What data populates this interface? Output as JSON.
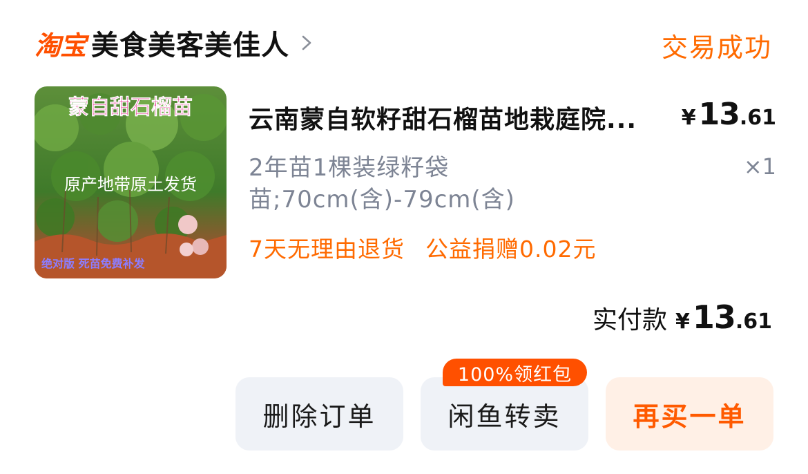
{
  "header": {
    "logo_text": "淘宝",
    "shop_name": "美食美客美佳人",
    "status": "交易成功"
  },
  "product": {
    "image": {
      "overlay_title": "蒙自甜石榴苗",
      "overlay_middle": "原产地带原土发货",
      "overlay_bottom": "绝对版 死苗免费补发"
    },
    "title": "云南蒙自软籽甜石榴苗地栽庭院...",
    "price": {
      "currency": "¥",
      "integer": "13",
      "decimal": ".61"
    },
    "sku": "2年苗1棵装绿籽袋苗;70cm(含)-79cm(含)",
    "quantity": "×1",
    "tags": [
      "7天无理由退货",
      "公益捐赠0.02元"
    ]
  },
  "total": {
    "label": "实付款",
    "currency": "¥",
    "integer": "13",
    "decimal": ".61"
  },
  "actions": {
    "delete_label": "删除订单",
    "resell_label": "闲鱼转卖",
    "resell_badge": "100%领红包",
    "rebuy_label": "再买一单"
  },
  "colors": {
    "brand_orange": "#ff5000",
    "status_orange": "#ff6a00",
    "secondary_text": "#7d8494",
    "button_gray": "#eff2f7",
    "button_orange_bg": "#fff0e6"
  }
}
